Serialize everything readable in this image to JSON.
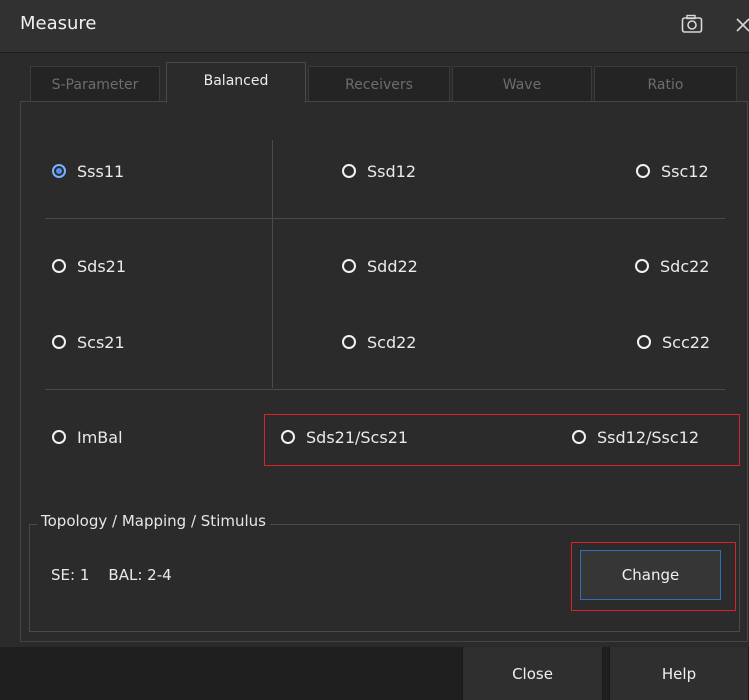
{
  "window": {
    "title": "Measure"
  },
  "tabs": [
    {
      "label": "S-Parameter",
      "active": false
    },
    {
      "label": "Balanced",
      "active": true
    },
    {
      "label": "Receivers",
      "active": false
    },
    {
      "label": "Wave",
      "active": false
    },
    {
      "label": "Ratio",
      "active": false
    }
  ],
  "options": {
    "sss11": "Sss11",
    "ssd12": "Ssd12",
    "ssc12": "Ssc12",
    "sds21": "Sds21",
    "sdd22": "Sdd22",
    "sdc22": "Sdc22",
    "scs21": "Scs21",
    "scd22": "Scd22",
    "scc22": "Scc22",
    "imbal": "ImBal",
    "sds21_scs21": "Sds21/Scs21",
    "ssd12_ssc12": "Ssd12/Ssc12",
    "selected": "Sss11"
  },
  "topology": {
    "title": "Topology / Mapping / Stimulus",
    "summary": "SE: 1    BAL: 2-4",
    "change_label": "Change"
  },
  "footer": {
    "close_label": "Close",
    "help_label": "Help"
  },
  "colors": {
    "accent": "#4d90fe",
    "highlight": "#d8222c",
    "background": "#2b2b2b"
  },
  "icons": {
    "camera": "camera-icon",
    "close": "close-icon"
  }
}
